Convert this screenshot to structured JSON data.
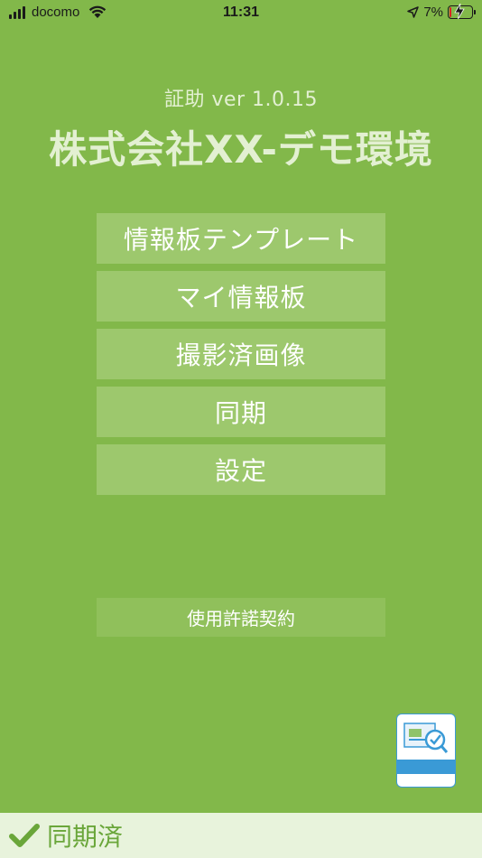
{
  "status_bar": {
    "carrier": "docomo",
    "time": "11:31",
    "battery_percent": "7%",
    "battery_level": 0.07,
    "icons": [
      "signal-icon",
      "wifi-icon",
      "location-arrow-icon",
      "battery-icon"
    ]
  },
  "header": {
    "app_version": "証助 ver 1.0.15",
    "company": "株式会社XX-デモ環境"
  },
  "menu": {
    "items": [
      {
        "label": "情報板テンプレート"
      },
      {
        "label": "マイ情報板"
      },
      {
        "label": "撮影済画像"
      },
      {
        "label": "同期"
      },
      {
        "label": "設定"
      }
    ]
  },
  "license": {
    "label": "使用許諾契約"
  },
  "bottom": {
    "sync_status": "同期済"
  },
  "colors": {
    "background": "#82b84a",
    "button": "#9dc86d",
    "bottom_bar": "#e8f3dc",
    "accent_text": "#6aa63a"
  }
}
